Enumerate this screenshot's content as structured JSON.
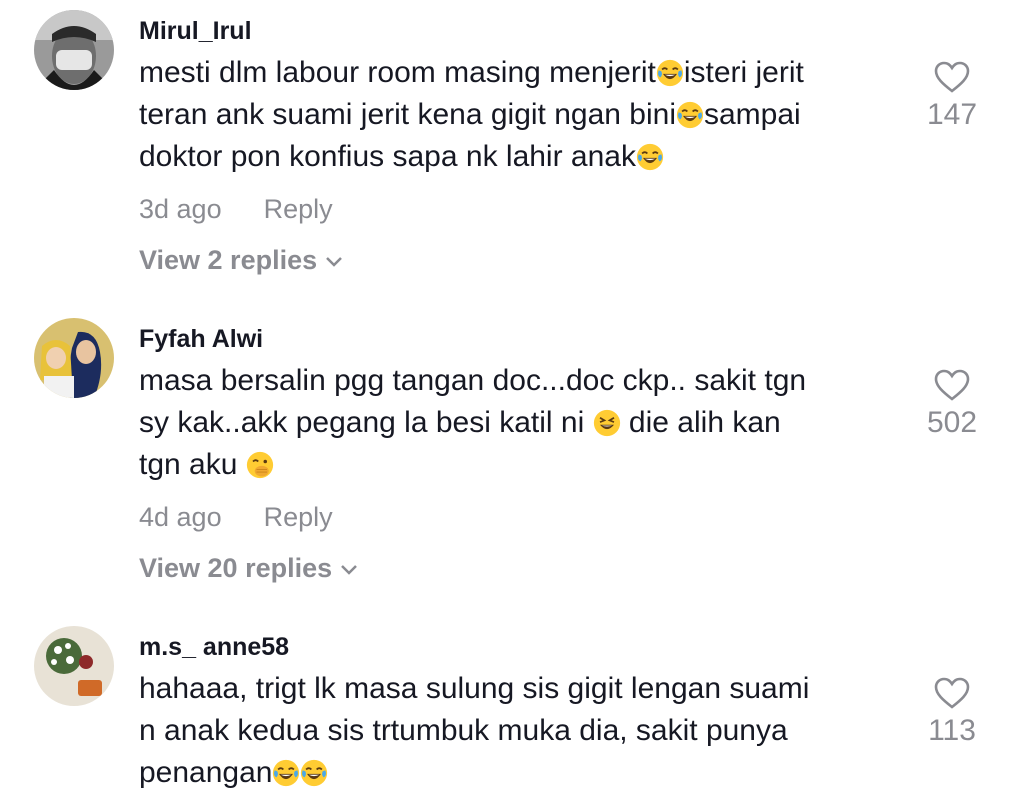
{
  "comments": [
    {
      "username": "Mirul_Irul",
      "text_lines": [
        "mesti dlm labour room masing menjerit",
        "isteri jerit",
        "teran ank suami jerit kena gigit ngan bini",
        "sampai",
        "doktor pon konfius sapa nk lahir anak"
      ],
      "time": "3d ago",
      "reply_label": "Reply",
      "view_replies": "View 2 replies",
      "likes": "147"
    },
    {
      "username": "Fyfah Alwi",
      "text_lines": [
        "masa bersalin pgg tangan doc...doc ckp.. sakit tgn",
        "sy kak..akk pegang la besi katil ni",
        " die alih kan",
        "tgn aku"
      ],
      "time": "4d ago",
      "reply_label": "Reply",
      "view_replies": "View 20 replies",
      "likes": "502"
    },
    {
      "username": "m.s_ anne58",
      "text_lines": [
        "hahaaa, trigt lk masa sulung sis gigit lengan suami",
        "n anak kedua sis trtumbuk muka dia, sakit punya",
        "penangan"
      ],
      "likes": "113"
    }
  ],
  "icons": {
    "heart": "heart-outline-icon",
    "chevron": "chevron-down-icon",
    "emoji_laugh": "tears-of-joy-emoji",
    "emoji_squint": "grinning-squinting-emoji",
    "emoji_hand": "hand-over-mouth-emoji"
  },
  "colors": {
    "primary_text": "#161823",
    "secondary_text": "#8a8b91"
  }
}
